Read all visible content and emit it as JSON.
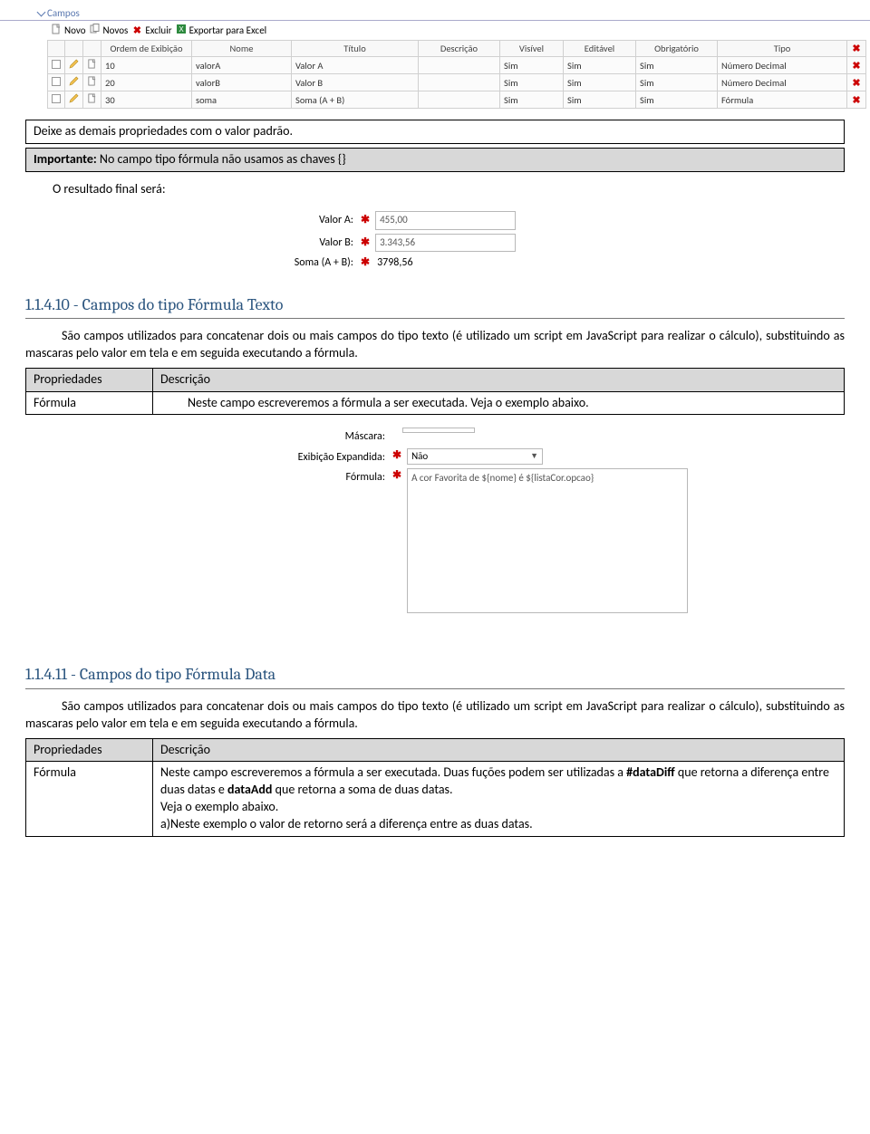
{
  "panel": {
    "title": "Campos",
    "toolbar": {
      "novo": "Novo",
      "novos": "Novos",
      "excluir": "Excluir",
      "exportar": "Exportar para Excel"
    }
  },
  "grid": {
    "headers": {
      "ordem": "Ordem de Exibição",
      "nome": "Nome",
      "titulo": "Título",
      "descricao": "Descrição",
      "visivel": "Visível",
      "editavel": "Editável",
      "obrigatorio": "Obrigatório",
      "tipo": "Tipo"
    },
    "rows": [
      {
        "ordem": "10",
        "nome": "valorA",
        "titulo": "Valor A",
        "descricao": "",
        "visivel": "Sim",
        "editavel": "Sim",
        "obrigatorio": "Sim",
        "tipo": "Número Decimal"
      },
      {
        "ordem": "20",
        "nome": "valorB",
        "titulo": "Valor B",
        "descricao": "",
        "visivel": "Sim",
        "editavel": "Sim",
        "obrigatorio": "Sim",
        "tipo": "Número Decimal"
      },
      {
        "ordem": "30",
        "nome": "soma",
        "titulo": "Soma (A + B)",
        "descricao": "",
        "visivel": "Sim",
        "editavel": "Sim",
        "obrigatorio": "Sim",
        "tipo": "Fórmula"
      }
    ]
  },
  "doc": {
    "line1": "Deixe as demais propriedades com o valor padrão.",
    "important_prefix": "Importante:",
    "important_rest": " No campo tipo fórmula não usamos as chaves {}",
    "result_line": "O resultado final será:",
    "form1": {
      "valorA_label": "Valor A:",
      "valorA_value": "455,00",
      "valorB_label": "Valor B:",
      "valorB_value": "3.343,56",
      "soma_label": "Soma (A + B):",
      "soma_value": "3798,56"
    },
    "h10": "1.1.4.10 - Campos do tipo Fórmula Texto",
    "p10": "São campos utilizados para concatenar dois ou mais campos do tipo texto (é utilizado um script em JavaScript para realizar o cálculo), substituindo as mascaras pelo valor em tela e em seguida executando a fórmula.",
    "props_header_c1": "Propriedades",
    "props_header_c2": "Descrição",
    "props_row_c1": "Fórmula",
    "props_row_c2": "Neste campo escreveremos a fórmula a ser executada. Veja o exemplo abaixo.",
    "form2": {
      "mascara_label": "Máscara:",
      "exibicao_label": "Exibição Expandida:",
      "exibicao_value": "Não",
      "formula_label": "Fórmula:",
      "formula_value": "A cor Favorita de ${nome} é ${listaCor.opcao}"
    },
    "h11": "1.1.4.11 - Campos do tipo Fórmula Data",
    "p11": "São campos utilizados para concatenar dois ou mais campos do tipo texto (é utilizado um script em JavaScript para realizar o cálculo), substituindo as mascaras pelo valor em tela e em seguida executando a fórmula.",
    "t2_row_pre": "Neste campo escreveremos a fórmula a ser executada.  Duas fuções podem ser utilizadas a ",
    "t2_row_b1": "#dataDiff",
    "t2_row_mid": " que retorna a diferença entre duas datas e  ",
    "t2_row_b2": "dataAdd",
    "t2_row_post": " que retorna a soma de duas datas.",
    "t2_row_l2": "Veja o exemplo abaixo.",
    "t2_row_l3": "a)Neste exemplo o valor de retorno será a diferença entre as duas datas."
  }
}
